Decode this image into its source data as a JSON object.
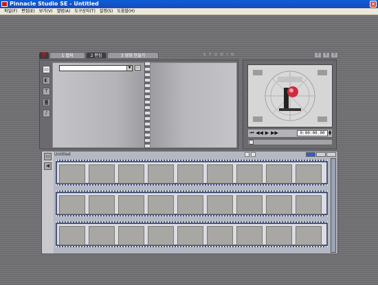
{
  "window": {
    "title": "Pinnacle Studio SE - Untitled",
    "close_label": "×"
  },
  "menu": [
    "파일(F)",
    "편집(E)",
    "보기(V)",
    "앨범(A)",
    "도구상자(T)",
    "설정(S)",
    "도움말(H)"
  ],
  "tabs": {
    "logo": "P",
    "items": [
      {
        "label": "1 캡쳐",
        "active": false
      },
      {
        "label": "2 편집",
        "active": true
      },
      {
        "label": "3 영화 만들기",
        "active": false
      }
    ]
  },
  "studio_label": "STUDIO",
  "help_buttons": [
    "?",
    "?",
    "?"
  ],
  "album": {
    "selector_value": "",
    "side_buttons": [
      "video-scenes-icon",
      "transitions-icon",
      "titles-icon",
      "photos-icon",
      "sound-effects-icon"
    ]
  },
  "player": {
    "timecode": "0:00:00.00",
    "controls": [
      "go-to-start-icon",
      "rewind-icon",
      "play-icon",
      "fast-forward-icon"
    ],
    "progress": 0
  },
  "movie": {
    "title": "Untitled",
    "strips": 3,
    "frames_per_strip": 9
  },
  "colors": {
    "accent": "#1a49b8",
    "logo_red": "#d21414",
    "film_blue": "#4b5678"
  }
}
